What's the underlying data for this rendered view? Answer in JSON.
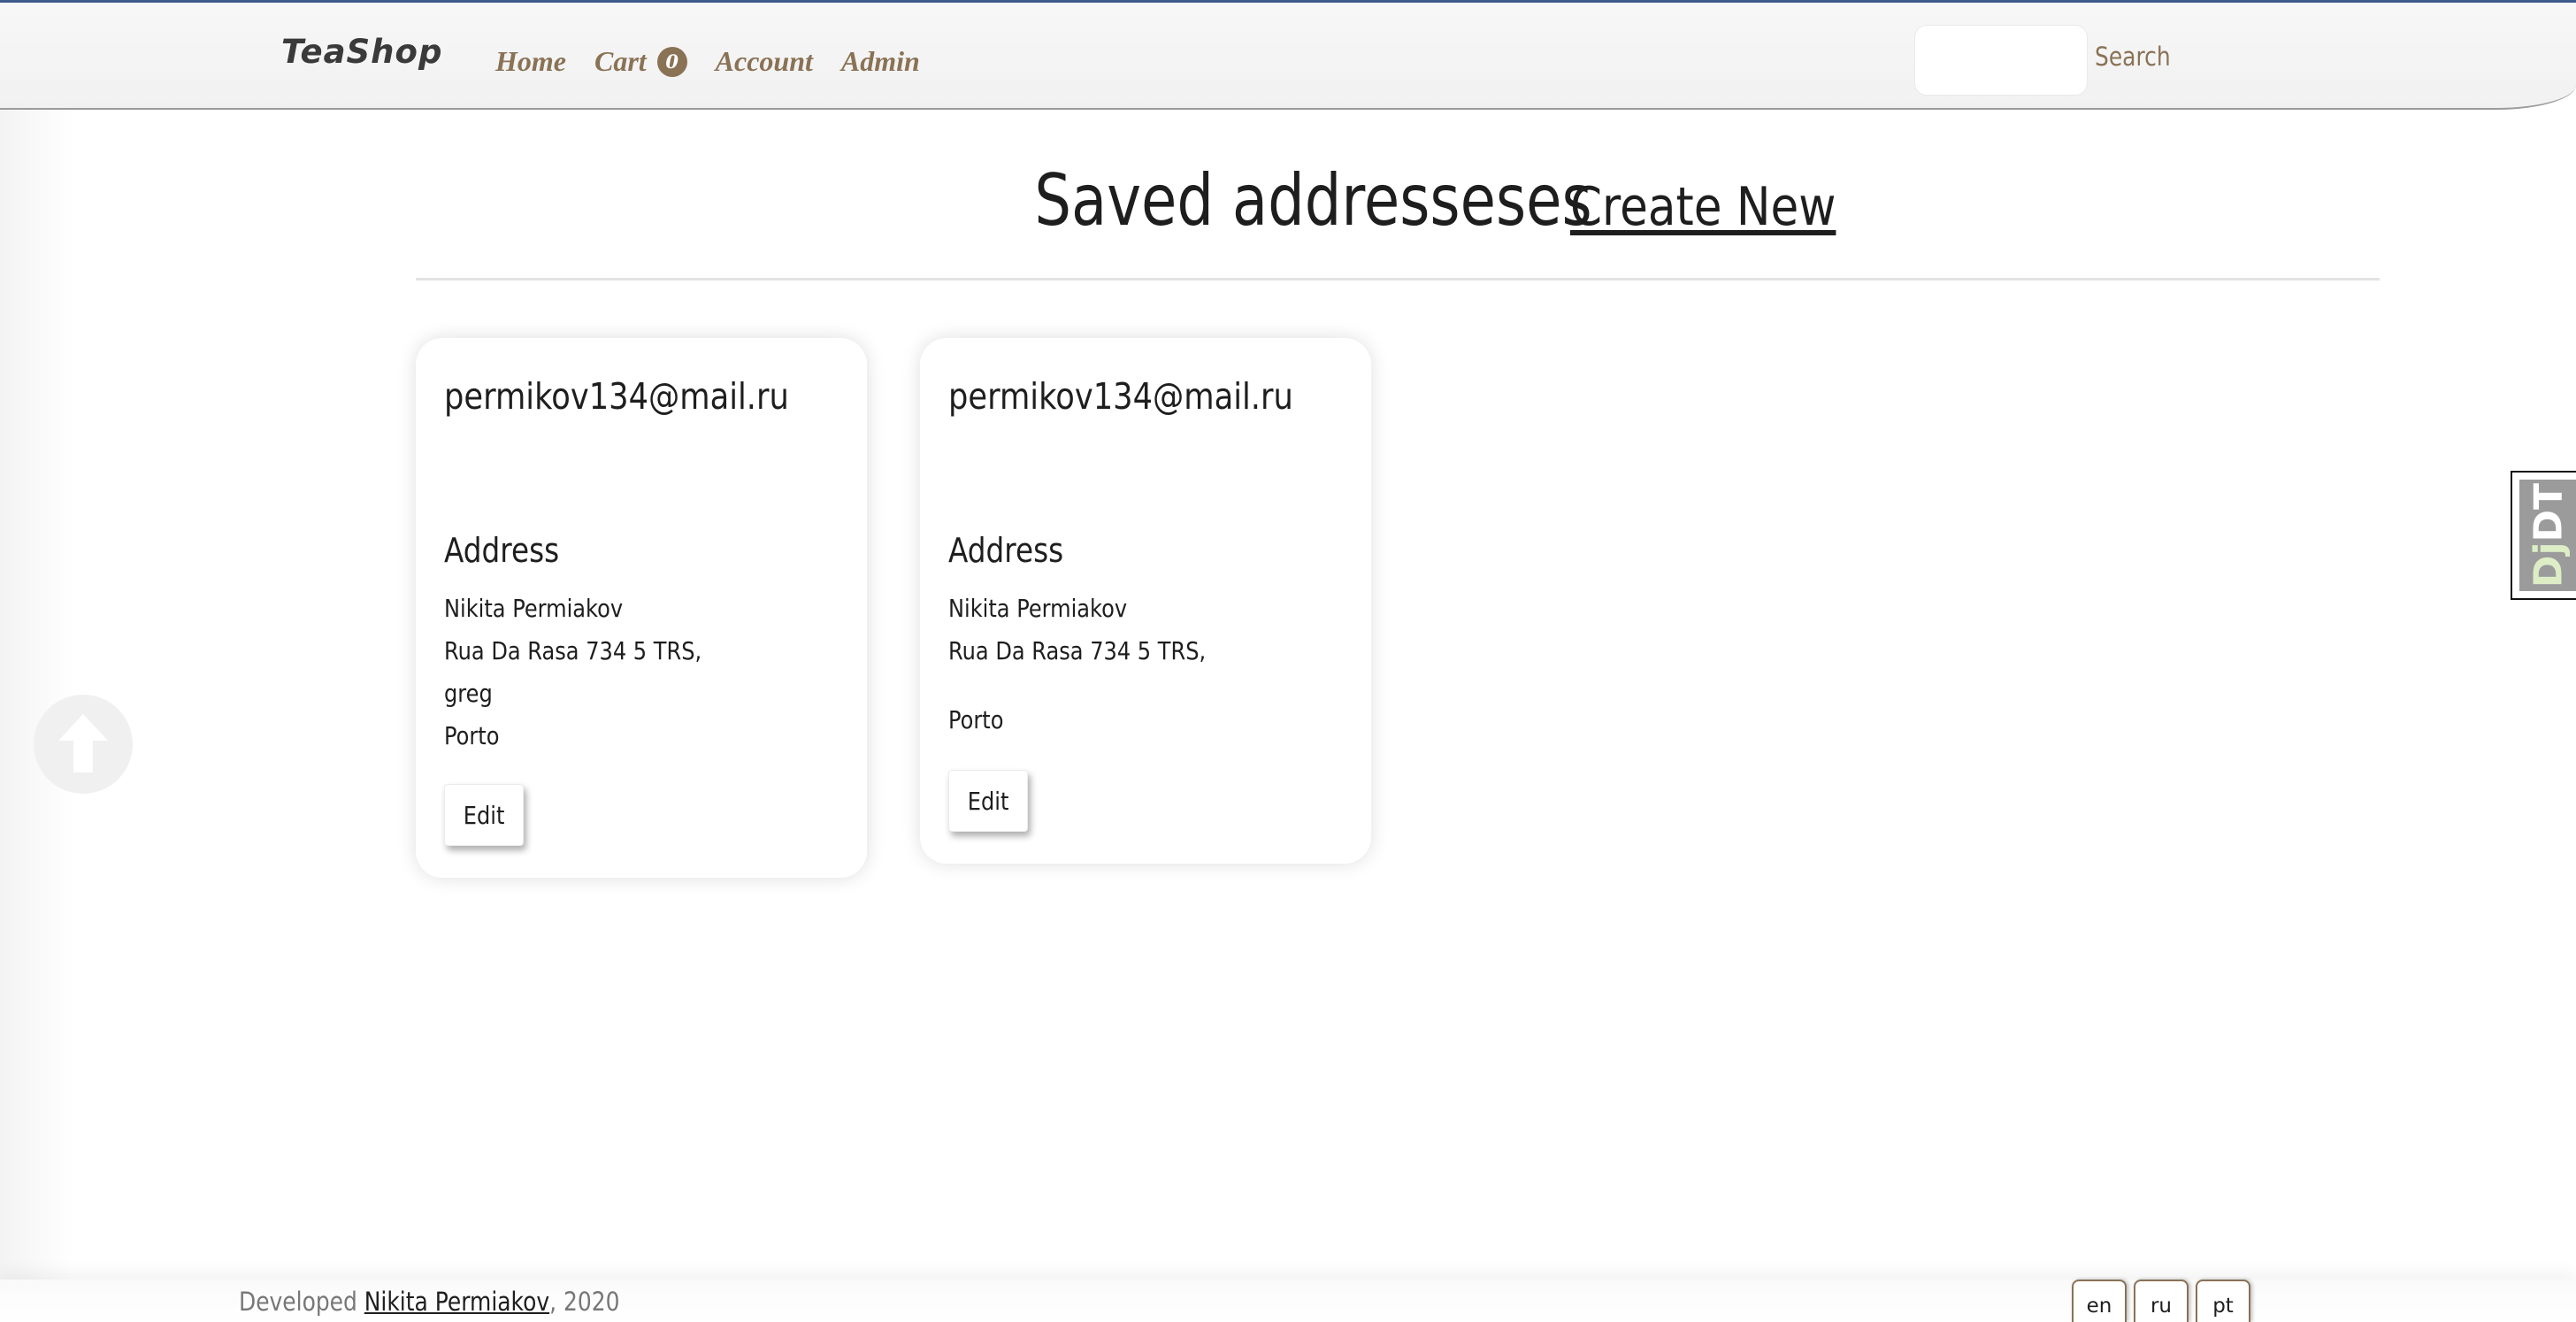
{
  "navbar": {
    "brand": "TeaShop",
    "links": {
      "home": "Home",
      "cart": "Cart",
      "cart_count": "0",
      "account": "Account",
      "admin": "Admin"
    },
    "search_value": "",
    "search_button": "Search"
  },
  "page": {
    "title": "Saved addresseses",
    "create_link": "Create New"
  },
  "addresses": [
    {
      "email": "permikov134@mail.ru",
      "address_title": "Address",
      "name": "Nikita Permiakov",
      "street": "Rua Da Rasa 734 5 TRS,",
      "line2": "greg",
      "city": "Porto",
      "edit_label": "Edit"
    },
    {
      "email": "permikov134@mail.ru",
      "address_title": "Address",
      "name": "Nikita Permiakov",
      "street": "Rua Da Rasa 734 5 TRS,",
      "line2": "",
      "city": "Porto",
      "edit_label": "Edit"
    }
  ],
  "djdt": {
    "dj": "Dj",
    "dt": "DT"
  },
  "footer": {
    "prefix": "Developed ",
    "author": "Nikita Permiakov",
    "suffix": ", 2020",
    "languages": [
      "en",
      "ru",
      "pt"
    ]
  },
  "colors": {
    "accent": "#8a7255",
    "topline": "#3d5a8c"
  },
  "icons": {
    "scroll_top": "arrow-up-circle-icon"
  }
}
